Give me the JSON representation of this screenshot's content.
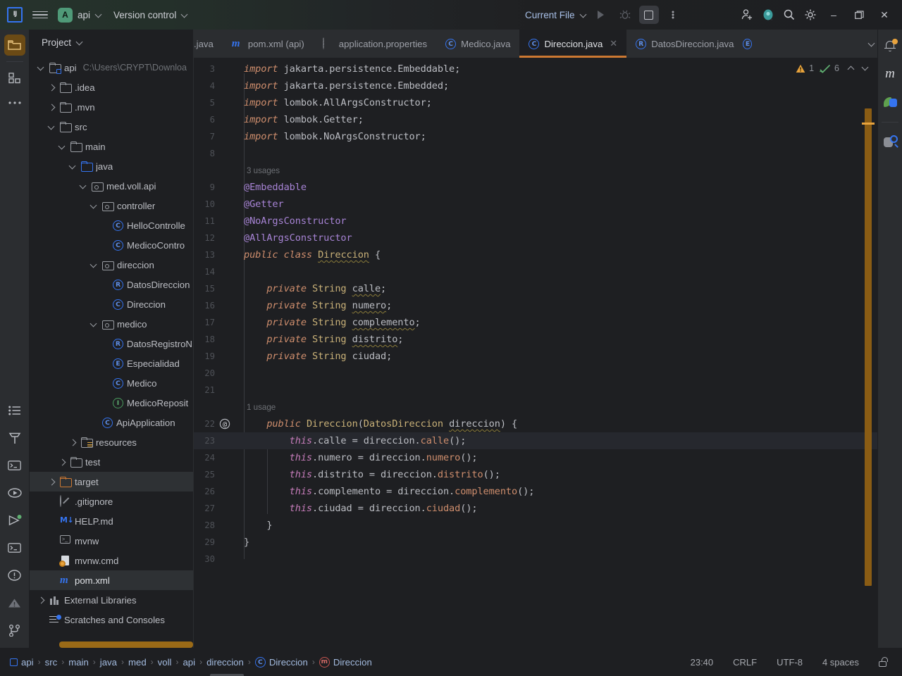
{
  "titlebar": {
    "logo": "IJ",
    "menu_icon": "hamburger-menu-icon",
    "project_chip": "A",
    "project_name": "api",
    "vcs_label": "Version control",
    "run_config": "Current File",
    "buttons": {
      "run": "run-icon",
      "debug": "debug-icon",
      "stop": "stop-icon",
      "more": "more-vertical-icon",
      "share": "add-user-icon",
      "account": "account-icon",
      "search": "search-icon",
      "settings": "gear-icon",
      "minimize": "–",
      "maximize": "❐",
      "close": "✕"
    }
  },
  "left_rail": {
    "top": [
      "project-folder-icon",
      "structure-icon",
      "more-tools-icon"
    ],
    "bottom": [
      "todo-icon",
      "build-hammer-icon",
      "terminal-icon",
      "services-icon",
      "run-icon",
      "terminal2-icon",
      "problems-icon",
      "warnings-icon",
      "git-branch-icon"
    ]
  },
  "project_panel": {
    "title": "Project",
    "tree": [
      {
        "depth": 0,
        "arrow": "down",
        "icon": "module-folder-icon",
        "label": "api",
        "path": "C:\\Users\\CRYPT\\Downloa",
        "selected": false
      },
      {
        "depth": 1,
        "arrow": "right",
        "icon": "folder-icon",
        "label": ".idea",
        "path": "",
        "selected": false
      },
      {
        "depth": 1,
        "arrow": "right",
        "icon": "folder-icon",
        "label": ".mvn",
        "path": "",
        "selected": false
      },
      {
        "depth": 1,
        "arrow": "down",
        "icon": "folder-icon",
        "label": "src",
        "path": "",
        "selected": false
      },
      {
        "depth": 2,
        "arrow": "down",
        "icon": "folder-icon",
        "label": "main",
        "path": "",
        "selected": false
      },
      {
        "depth": 3,
        "arrow": "down",
        "icon": "source-folder-icon",
        "label": "java",
        "path": "",
        "selected": false
      },
      {
        "depth": 4,
        "arrow": "down",
        "icon": "package-icon",
        "label": "med.voll.api",
        "path": "",
        "selected": false
      },
      {
        "depth": 5,
        "arrow": "down",
        "icon": "package-icon",
        "label": "controller",
        "path": "",
        "selected": false
      },
      {
        "depth": 6,
        "arrow": "none",
        "icon": "class-icon",
        "label": "HelloControlle",
        "path": "",
        "selected": false
      },
      {
        "depth": 6,
        "arrow": "none",
        "icon": "class-icon",
        "label": "MedicoContro",
        "path": "",
        "selected": false
      },
      {
        "depth": 5,
        "arrow": "down",
        "icon": "package-icon",
        "label": "direccion",
        "path": "",
        "selected": false
      },
      {
        "depth": 6,
        "arrow": "none",
        "icon": "record-icon",
        "label": "DatosDireccion",
        "path": "",
        "selected": false
      },
      {
        "depth": 6,
        "arrow": "none",
        "icon": "class-icon",
        "label": "Direccion",
        "path": "",
        "selected": false
      },
      {
        "depth": 5,
        "arrow": "down",
        "icon": "package-icon",
        "label": "medico",
        "path": "",
        "selected": false
      },
      {
        "depth": 6,
        "arrow": "none",
        "icon": "record-icon",
        "label": "DatosRegistroN",
        "path": "",
        "selected": false
      },
      {
        "depth": 6,
        "arrow": "none",
        "icon": "enum-icon",
        "label": "Especialidad",
        "path": "",
        "selected": false
      },
      {
        "depth": 6,
        "arrow": "none",
        "icon": "class-icon",
        "label": "Medico",
        "path": "",
        "selected": false
      },
      {
        "depth": 6,
        "arrow": "none",
        "icon": "interface-icon",
        "label": "MedicoReposit",
        "path": "",
        "selected": false
      },
      {
        "depth": 5,
        "arrow": "none",
        "icon": "class-icon",
        "label": "ApiApplication",
        "path": "",
        "selected": false
      },
      {
        "depth": 3,
        "arrow": "right",
        "icon": "resources-folder-icon",
        "label": "resources",
        "path": "",
        "selected": false
      },
      {
        "depth": 2,
        "arrow": "right",
        "icon": "folder-icon",
        "label": "test",
        "path": "",
        "selected": false
      },
      {
        "depth": 1,
        "arrow": "right",
        "icon": "target-folder-icon",
        "label": "target",
        "path": "",
        "selected": true
      },
      {
        "depth": 1,
        "arrow": "none",
        "icon": "gitignore-icon",
        "label": ".gitignore",
        "path": "",
        "selected": false
      },
      {
        "depth": 1,
        "arrow": "none",
        "icon": "markdown-icon",
        "label": "HELP.md",
        "path": "",
        "selected": false
      },
      {
        "depth": 1,
        "arrow": "none",
        "icon": "shell-script-icon",
        "label": "mvnw",
        "path": "",
        "selected": false
      },
      {
        "depth": 1,
        "arrow": "none",
        "icon": "cmd-script-icon",
        "label": "mvnw.cmd",
        "path": "",
        "selected": false
      },
      {
        "depth": 1,
        "arrow": "none",
        "icon": "maven-icon",
        "label": "pom.xml",
        "path": "",
        "selected": false,
        "file_active": true
      },
      {
        "depth": 0,
        "arrow": "right",
        "icon": "external-libraries-icon",
        "label": "External Libraries",
        "path": "",
        "selected": false
      },
      {
        "depth": 0,
        "arrow": "none",
        "icon": "scratches-icon",
        "label": "Scratches and Consoles",
        "path": "",
        "selected": false
      }
    ]
  },
  "tabs": [
    {
      "icon": "",
      "label": ".java",
      "active": false,
      "clipped": true
    },
    {
      "icon": "maven-icon",
      "label": "pom.xml (api)",
      "active": false
    },
    {
      "icon": "properties-icon",
      "label": "application.properties",
      "active": false
    },
    {
      "icon": "class-icon",
      "label": "Medico.java",
      "active": false
    },
    {
      "icon": "class-icon",
      "label": "Direccion.java",
      "active": true,
      "close": "✕"
    },
    {
      "icon": "record-icon",
      "label": "DatosDireccion.java",
      "active": false
    },
    {
      "icon": "enum-icon",
      "label": "",
      "active": false,
      "clipped": true
    }
  ],
  "tabs_right": {
    "chevron": "chevron-down-icon",
    "more": "more-vertical-icon"
  },
  "inspections": {
    "warning_icon": "warning-triangle-icon",
    "warning_count": "1",
    "ok_icon": "inspection-ok-icon",
    "ok_count": "6",
    "prev": "chevron-up-icon",
    "next": "chevron-down-icon"
  },
  "right_rail": [
    "notifications-bell-icon",
    "maven-icon",
    "spring-database-icon",
    "database-search-icon"
  ],
  "code": {
    "lines": [
      {
        "n": "3",
        "hint": "",
        "tokens": [
          {
            "t": "import ",
            "c": "kw"
          },
          {
            "t": "jakarta.persistence.Embeddable",
            "c": "pkg"
          },
          {
            "t": ";",
            "c": "punc"
          }
        ]
      },
      {
        "n": "4",
        "hint": "",
        "tokens": [
          {
            "t": "import ",
            "c": "kw"
          },
          {
            "t": "jakarta.persistence.Embedded",
            "c": "pkg"
          },
          {
            "t": ";",
            "c": "punc"
          }
        ]
      },
      {
        "n": "5",
        "hint": "",
        "tokens": [
          {
            "t": "import ",
            "c": "kw"
          },
          {
            "t": "lombok.AllArgsConstructor",
            "c": "pkg"
          },
          {
            "t": ";",
            "c": "punc"
          }
        ]
      },
      {
        "n": "6",
        "hint": "",
        "tokens": [
          {
            "t": "import ",
            "c": "kw"
          },
          {
            "t": "lombok.Getter",
            "c": "pkg"
          },
          {
            "t": ";",
            "c": "punc"
          }
        ]
      },
      {
        "n": "7",
        "hint": "",
        "tokens": [
          {
            "t": "import ",
            "c": "kw"
          },
          {
            "t": "lombok.NoArgsConstructor",
            "c": "pkg"
          },
          {
            "t": ";",
            "c": "punc"
          }
        ]
      },
      {
        "n": "8",
        "hint": "",
        "tokens": []
      },
      {
        "n": "",
        "hint": "3 usages",
        "tokens": []
      },
      {
        "n": "9",
        "hint": "",
        "tokens": [
          {
            "t": "@Embeddable",
            "c": "annp"
          }
        ]
      },
      {
        "n": "10",
        "hint": "",
        "tokens": [
          {
            "t": "@Getter",
            "c": "annp"
          }
        ]
      },
      {
        "n": "11",
        "hint": "",
        "tokens": [
          {
            "t": "@NoArgsConstructor",
            "c": "annp"
          }
        ]
      },
      {
        "n": "12",
        "hint": "",
        "tokens": [
          {
            "t": "@AllArgsConstructor",
            "c": "annp"
          }
        ]
      },
      {
        "n": "13",
        "hint": "",
        "tokens": [
          {
            "t": "public ",
            "c": "kw"
          },
          {
            "t": "class ",
            "c": "kw"
          },
          {
            "t": "Direccion",
            "c": "cls wavy"
          },
          {
            "t": " {",
            "c": "brace"
          }
        ]
      },
      {
        "n": "14",
        "hint": "",
        "tokens": []
      },
      {
        "n": "15",
        "hint": "",
        "tokens": [
          {
            "t": "    private ",
            "c": "kw"
          },
          {
            "t": "String ",
            "c": "cls"
          },
          {
            "t": "calle",
            "c": "fld wavy"
          },
          {
            "t": ";",
            "c": "punc"
          }
        ]
      },
      {
        "n": "16",
        "hint": "",
        "tokens": [
          {
            "t": "    private ",
            "c": "kw"
          },
          {
            "t": "String ",
            "c": "cls"
          },
          {
            "t": "numero",
            "c": "fld wavy"
          },
          {
            "t": ";",
            "c": "punc"
          }
        ]
      },
      {
        "n": "17",
        "hint": "",
        "tokens": [
          {
            "t": "    private ",
            "c": "kw"
          },
          {
            "t": "String ",
            "c": "cls"
          },
          {
            "t": "complemento",
            "c": "fld wavy"
          },
          {
            "t": ";",
            "c": "punc"
          }
        ]
      },
      {
        "n": "18",
        "hint": "",
        "tokens": [
          {
            "t": "    private ",
            "c": "kw"
          },
          {
            "t": "String ",
            "c": "cls"
          },
          {
            "t": "distrito",
            "c": "fld wavy"
          },
          {
            "t": ";",
            "c": "punc"
          }
        ]
      },
      {
        "n": "19",
        "hint": "",
        "tokens": [
          {
            "t": "    private ",
            "c": "kw"
          },
          {
            "t": "String ",
            "c": "cls"
          },
          {
            "t": "ciudad",
            "c": "fld"
          },
          {
            "t": ";",
            "c": "punc"
          }
        ]
      },
      {
        "n": "20",
        "hint": "",
        "tokens": []
      },
      {
        "n": "21",
        "hint": "",
        "tokens": []
      },
      {
        "n": "",
        "hint": "1 usage",
        "tokens": []
      },
      {
        "n": "22",
        "hint": "",
        "gutter": "@",
        "tokens": [
          {
            "t": "    public ",
            "c": "kw"
          },
          {
            "t": "Direccion",
            "c": "mth2"
          },
          {
            "t": "(",
            "c": "punc"
          },
          {
            "t": "DatosDireccion ",
            "c": "cls"
          },
          {
            "t": "direccion",
            "c": "parm wavy"
          },
          {
            "t": ") {",
            "c": "punc"
          }
        ]
      },
      {
        "n": "23",
        "hint": "",
        "current": true,
        "tokens": [
          {
            "t": "        this",
            "c": "kw2"
          },
          {
            "t": ".calle = ",
            "c": "fld"
          },
          {
            "t": "direccion",
            "c": "parm"
          },
          {
            "t": ".",
            "c": "punc"
          },
          {
            "t": "calle",
            "c": "mth"
          },
          {
            "t": "();",
            "c": "punc"
          }
        ]
      },
      {
        "n": "24",
        "hint": "",
        "tokens": [
          {
            "t": "        this",
            "c": "kw2"
          },
          {
            "t": ".numero = ",
            "c": "fld"
          },
          {
            "t": "direccion",
            "c": "parm"
          },
          {
            "t": ".",
            "c": "punc"
          },
          {
            "t": "numero",
            "c": "mth"
          },
          {
            "t": "();",
            "c": "punc"
          }
        ]
      },
      {
        "n": "25",
        "hint": "",
        "tokens": [
          {
            "t": "        this",
            "c": "kw2"
          },
          {
            "t": ".distrito = ",
            "c": "fld"
          },
          {
            "t": "direccion",
            "c": "parm"
          },
          {
            "t": ".",
            "c": "punc"
          },
          {
            "t": "distrito",
            "c": "mth"
          },
          {
            "t": "();",
            "c": "punc"
          }
        ]
      },
      {
        "n": "26",
        "hint": "",
        "tokens": [
          {
            "t": "        this",
            "c": "kw2"
          },
          {
            "t": ".complemento = ",
            "c": "fld"
          },
          {
            "t": "direccion",
            "c": "parm"
          },
          {
            "t": ".",
            "c": "punc"
          },
          {
            "t": "complemento",
            "c": "mth"
          },
          {
            "t": "();",
            "c": "punc"
          }
        ]
      },
      {
        "n": "27",
        "hint": "",
        "tokens": [
          {
            "t": "        this",
            "c": "kw2"
          },
          {
            "t": ".ciudad = ",
            "c": "fld"
          },
          {
            "t": "direccion",
            "c": "parm"
          },
          {
            "t": ".",
            "c": "punc"
          },
          {
            "t": "ciudad",
            "c": "mth"
          },
          {
            "t": "();",
            "c": "punc"
          }
        ]
      },
      {
        "n": "28",
        "hint": "",
        "tokens": [
          {
            "t": "    }",
            "c": "brace"
          }
        ]
      },
      {
        "n": "29",
        "hint": "",
        "tokens": [
          {
            "t": "}",
            "c": "brace"
          }
        ]
      },
      {
        "n": "30",
        "hint": "",
        "tokens": []
      }
    ]
  },
  "statusbar": {
    "breadcrumbs": [
      {
        "icon": "module-icon",
        "label": "api"
      },
      {
        "icon": "",
        "label": "src"
      },
      {
        "icon": "",
        "label": "main"
      },
      {
        "icon": "",
        "label": "java"
      },
      {
        "icon": "",
        "label": "med"
      },
      {
        "icon": "",
        "label": "voll"
      },
      {
        "icon": "",
        "label": "api"
      },
      {
        "icon": "",
        "label": "direccion"
      },
      {
        "icon": "class-icon",
        "label": "Direccion"
      },
      {
        "icon": "method-icon",
        "label": "Direccion"
      }
    ],
    "separator": "›",
    "caret_position": "23:40",
    "line_separator": "CRLF",
    "encoding": "UTF-8",
    "indent": "4 spaces",
    "lock_icon": "unlocked-icon"
  },
  "colors": {
    "accent_orange": "#cc7832",
    "background": "#1e1f22",
    "panel": "#2b2d30",
    "selection": "#2e3134",
    "link_blue": "#a3bbdf"
  }
}
